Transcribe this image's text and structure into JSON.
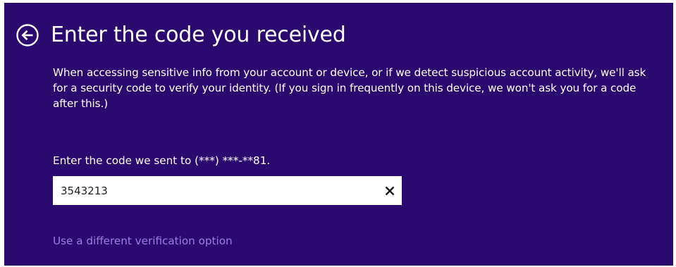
{
  "page": {
    "title": "Enter the code you received",
    "description": "When accessing sensitive info from your account or device, or if we detect suspicious account activity, we'll ask for a security code to verify your identity. (If you sign in frequently on this device, we won't ask you for a code after this.)"
  },
  "code_form": {
    "label": "Enter the code we sent to (***) ***-**81.",
    "value": "3543213",
    "placeholder": ""
  },
  "alternate_link": "Use a different verification option",
  "icons": {
    "back": "back-arrow-circle-icon",
    "clear": "close-x-icon"
  },
  "colors": {
    "background": "#2a0a6e",
    "text": "#ffffff",
    "link": "#9b7ee0",
    "input_background": "#ffffff"
  }
}
